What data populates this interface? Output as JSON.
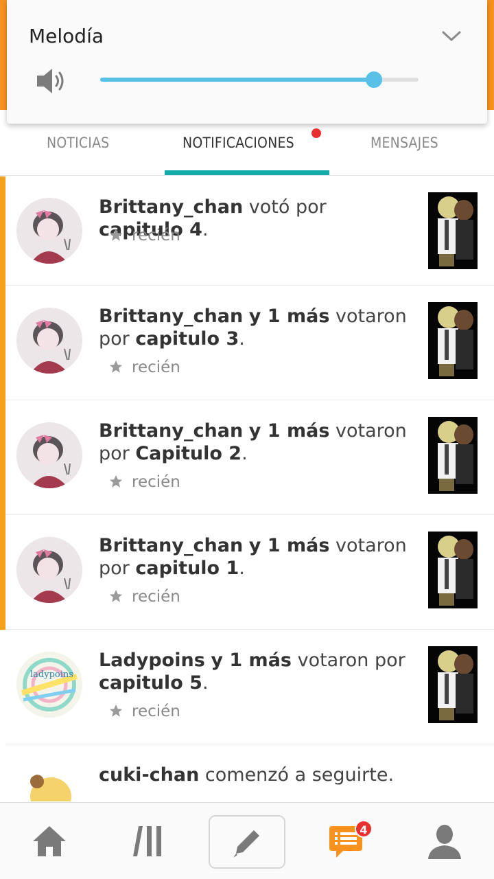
{
  "volume": {
    "title": "Melodía",
    "level": 0.86,
    "accent_color": "#59c0e8",
    "icons": {
      "speaker": "speaker-icon",
      "collapse": "chevron-down-icon"
    }
  },
  "tabs": [
    {
      "label": "NOTICIAS",
      "active": false
    },
    {
      "label": "NOTIFICACIONES",
      "active": true,
      "unread_dot": true
    },
    {
      "label": "MENSAJES",
      "active": false
    }
  ],
  "accent_color": "#13aaa7",
  "notifications": [
    {
      "user": "Brittany_chan",
      "others": "",
      "verb": "votó por",
      "target": "capitulo 4",
      "time": "recién",
      "unread": true
    },
    {
      "user": "Brittany_chan",
      "others": "y 1 más",
      "verb": "votaron por",
      "target": "capitulo 3",
      "time": "recién",
      "unread": true
    },
    {
      "user": "Brittany_chan",
      "others": "y 1 más",
      "verb": "votaron por",
      "target": "Capitulo 2",
      "time": "recién",
      "unread": true
    },
    {
      "user": "Brittany_chan",
      "others": "y 1 más",
      "verb": "votaron por",
      "target": "capitulo 1",
      "time": "recién",
      "unread": true
    },
    {
      "user": "Ladypoins",
      "others": "y 1 más",
      "verb": "votaron por",
      "target": "capitulo 5",
      "time": "recién",
      "unread": false
    },
    {
      "user": "cuki-chan",
      "others": "",
      "verb": "comenzó a seguirte",
      "target": "",
      "time": "",
      "unread": false
    }
  ],
  "avatar_text": {
    "ladypoins": "ladypoins"
  },
  "bottom_nav": {
    "items": [
      "home-icon",
      "library-icon",
      "compose-icon",
      "notifications-icon",
      "profile-icon"
    ],
    "notifications_badge": "4",
    "notifications_color": "#f7921e"
  }
}
